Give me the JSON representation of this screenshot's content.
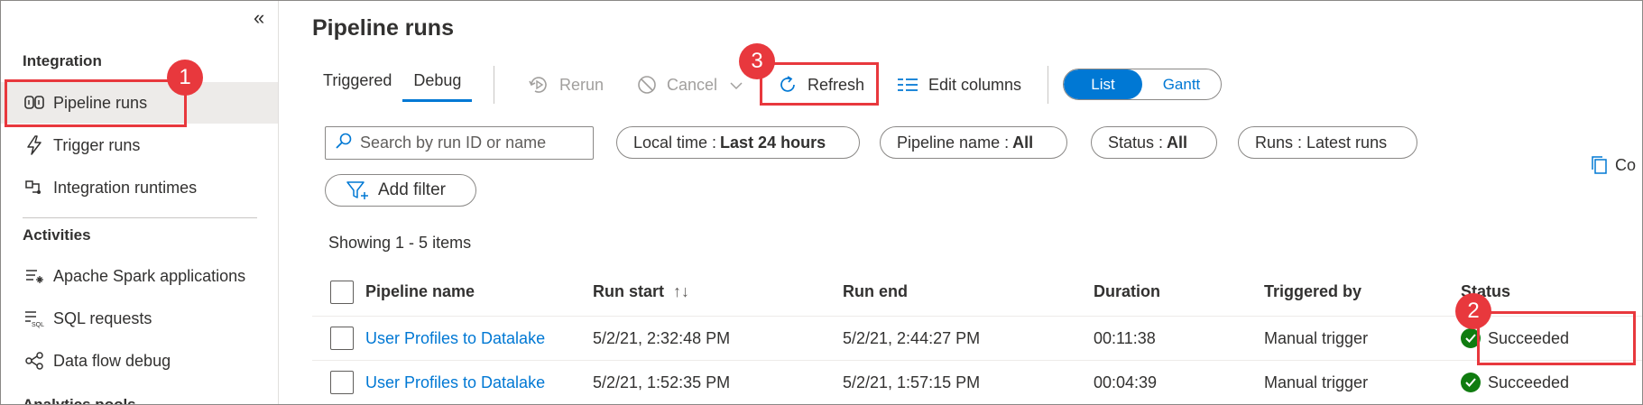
{
  "sidebar": {
    "collapse_icon": "double-chevron-left",
    "sections": {
      "integration": "Integration",
      "activities": "Activities",
      "analytics_partial": "Analytics pools"
    },
    "items": [
      {
        "label": "Pipeline runs",
        "icon": "pipeline-icon",
        "active": true
      },
      {
        "label": "Trigger runs",
        "icon": "lightning-icon"
      },
      {
        "label": "Integration runtimes",
        "icon": "runtime-icon"
      },
      {
        "label": "Apache Spark applications",
        "icon": "spark-list-icon"
      },
      {
        "label": "SQL requests",
        "icon": "sql-icon"
      },
      {
        "label": "Data flow debug",
        "icon": "dataflow-icon"
      }
    ]
  },
  "main": {
    "title": "Pipeline runs",
    "tabs": [
      {
        "label": "Triggered",
        "active": false
      },
      {
        "label": "Debug",
        "active": true
      }
    ],
    "toolbar": {
      "rerun": "Rerun",
      "cancel": "Cancel",
      "refresh": "Refresh",
      "edit_columns": "Edit columns"
    },
    "view_toggle": {
      "list": "List",
      "gantt": "Gantt",
      "selected": "List"
    },
    "search": {
      "placeholder": "Search by run ID or name"
    },
    "filters": [
      {
        "label": "Local time :",
        "value": "Last 24 hours"
      },
      {
        "label": "Pipeline name :",
        "value": "All"
      },
      {
        "label": "Status :",
        "value": "All"
      },
      {
        "label": "Runs : Latest runs",
        "value": ""
      }
    ],
    "add_filter": "Add filter",
    "copy_partial": "Co",
    "showing": "Showing 1 - 5 items",
    "table": {
      "columns": [
        "Pipeline name",
        "Run start",
        "Run end",
        "Duration",
        "Triggered by",
        "Status"
      ],
      "rows": [
        {
          "name": "User Profiles to Datalake",
          "run_start": "5/2/21, 2:32:48 PM",
          "run_end": "5/2/21, 2:44:27 PM",
          "duration": "00:11:38",
          "triggered_by": "Manual trigger",
          "status": "Succeeded"
        },
        {
          "name": "User Profiles to Datalake",
          "run_start": "5/2/21, 1:52:35 PM",
          "run_end": "5/2/21, 1:57:15 PM",
          "duration": "00:04:39",
          "triggered_by": "Manual trigger",
          "status": "Succeeded"
        }
      ]
    }
  },
  "callouts": {
    "one": "1",
    "two": "2",
    "three": "3"
  },
  "colors": {
    "accent": "#0078d4",
    "callout": "#e8383d",
    "success": "#107c10"
  }
}
